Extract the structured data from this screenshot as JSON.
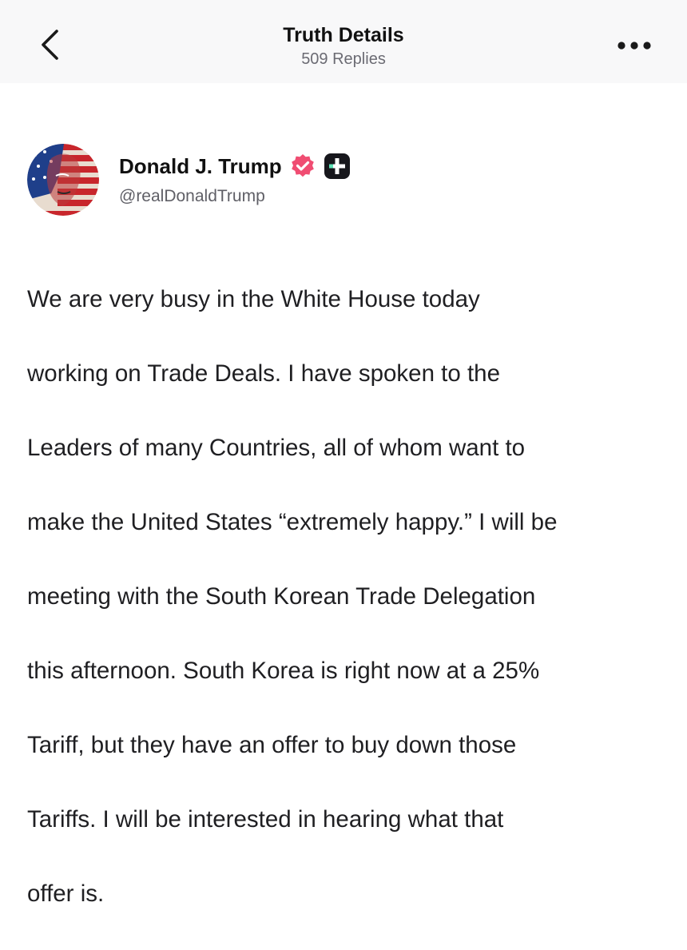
{
  "header": {
    "title": "Truth Details",
    "subtitle": "509 Replies",
    "back_icon": "chevron-left-icon",
    "more_icon": "more-horizontal-icon"
  },
  "author": {
    "name": "Donald J. Trump",
    "handle": "@realDonaldTrump",
    "verified_icon": "verified-badge-icon",
    "plus_icon": "truth-plus-badge-icon",
    "colors": {
      "verified": "#f04d72",
      "plus_badge": "#17171c",
      "plus_accent": "#5ee3b6"
    }
  },
  "post": {
    "lines": [
      "We are very busy in the White House today",
      "working on Trade Deals. I have spoken to the",
      "Leaders of many Countries, all of whom want to",
      "make the United States “extremely happy.” I will be",
      "meeting with the South Korean Trade Delegation",
      "this afternoon. South Korea is right now at a 25%",
      "Tariff, but they have an offer to buy down those",
      "Tariffs. I will be interested in hearing what that",
      "offer is."
    ]
  }
}
